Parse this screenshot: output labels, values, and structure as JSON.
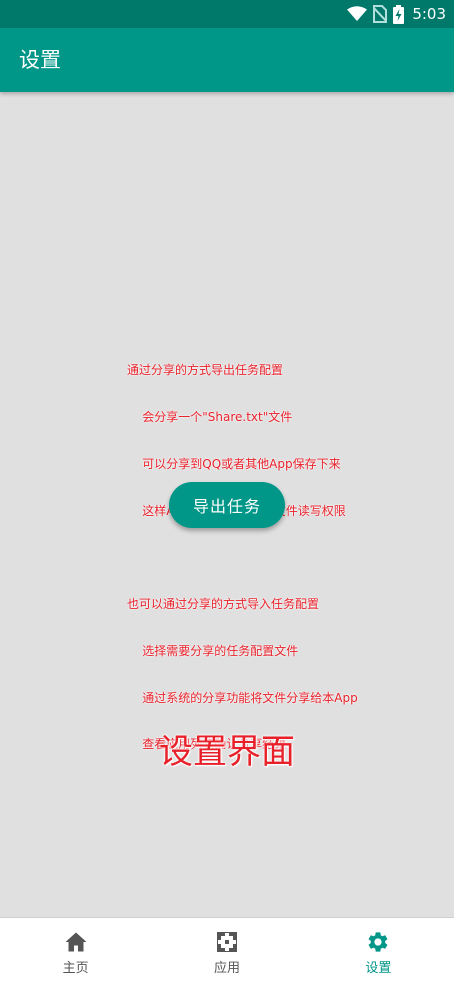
{
  "status_bar": {
    "time": "5:03"
  },
  "app_bar": {
    "title": "设置"
  },
  "info": {
    "lines": [
      "通过分享的方式导出任务配置",
      "    会分享一个\"Share.txt\"文件",
      "    可以分享到QQ或者其他App保存下来",
      "    这样App自身可以不需要文件读写权限",
      "",
      "也可以通过分享的方式导入任务配置",
      "    选择需要分享的任务配置文件",
      "    通过系统的分享功能将文件分享给本App",
      "    查看应用列表确认分享结果"
    ]
  },
  "export_button": {
    "label": "导出任务"
  },
  "caption": "设置界面",
  "bottom_nav": {
    "items": [
      {
        "label": "主页",
        "icon": "home-icon",
        "active": false
      },
      {
        "label": "应用",
        "icon": "apps-icon",
        "active": false
      },
      {
        "label": "设置",
        "icon": "gear-icon",
        "active": true
      }
    ]
  },
  "colors": {
    "primary": "#009688",
    "primary_dark": "#00796b",
    "accent_text": "#e8202a",
    "nav_inactive": "#555555"
  }
}
